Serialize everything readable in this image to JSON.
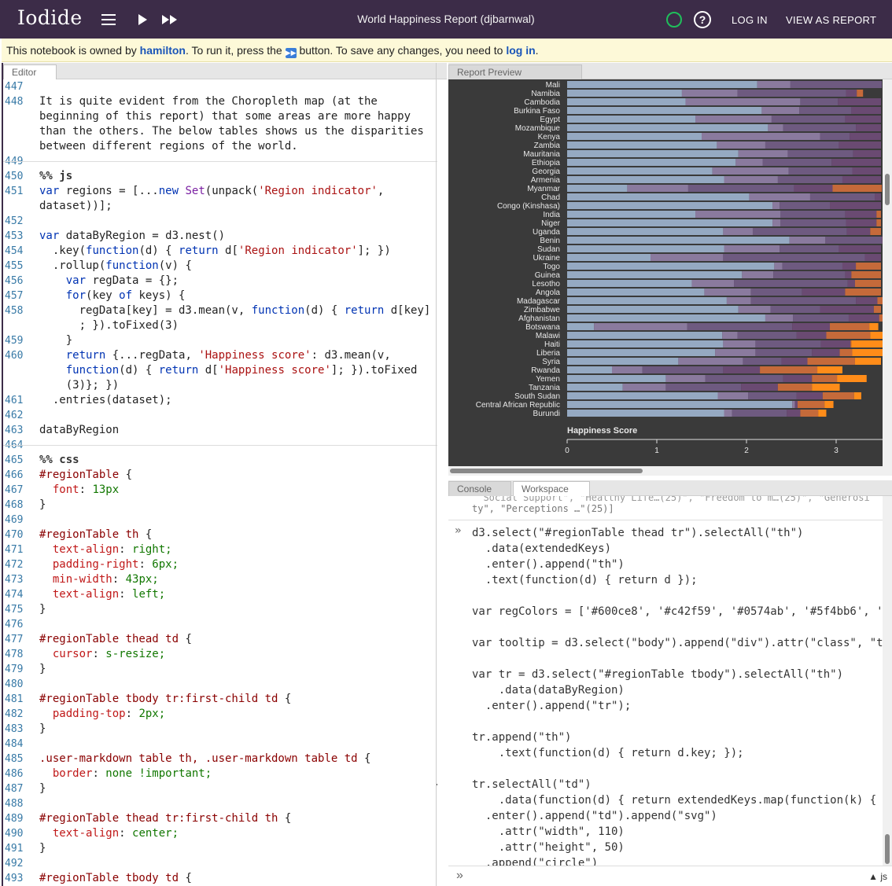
{
  "app": {
    "logo": "Iodide",
    "notebook_title": "World Happiness Report (djbarnwal)",
    "login_label": "LOG IN",
    "view_as_report_label": "VIEW AS REPORT"
  },
  "notice": {
    "prefix": "This notebook is owned by ",
    "owner": "hamilton",
    "middle": ". To run it, press the ",
    "button_glyph": "⏩",
    "after_button": " button. To save any changes, you need to ",
    "login_link": "log in",
    "suffix": "."
  },
  "editor": {
    "tab_label": "Editor",
    "lines": [
      {
        "n": "447",
        "t": ""
      },
      {
        "n": "448",
        "t": "It is quite evident from the Choropleth map (at the"
      },
      {
        "n": "",
        "t": "beginning of this report) that some areas are more happy"
      },
      {
        "n": "",
        "t": "than the others. The below tables shows us the disparities"
      },
      {
        "n": "",
        "t": "between different regions of the world."
      },
      {
        "n": "449",
        "t": ""
      },
      {
        "n": "450",
        "t": "%% js"
      },
      {
        "n": "451",
        "t": "var regions = [...new Set(unpack('Region indicator',"
      },
      {
        "n": "",
        "t": "dataset))];"
      },
      {
        "n": "452",
        "t": ""
      },
      {
        "n": "453",
        "t": "var dataByRegion = d3.nest()"
      },
      {
        "n": "454",
        "t": "  .key(function(d) { return d['Region indicator']; })"
      },
      {
        "n": "455",
        "t": "  .rollup(function(v) {"
      },
      {
        "n": "456",
        "t": "    var regData = {};"
      },
      {
        "n": "457",
        "t": "    for(key of keys) {"
      },
      {
        "n": "458",
        "t": "      regData[key] = d3.mean(v, function(d) { return d[key]"
      },
      {
        "n": "",
        "t": "      ; }).toFixed(3)"
      },
      {
        "n": "459",
        "t": "    }"
      },
      {
        "n": "460",
        "t": "    return {...regData, 'Happiness score': d3.mean(v,"
      },
      {
        "n": "",
        "t": "    function(d) { return d['Happiness score']; }).toFixed"
      },
      {
        "n": "",
        "t": "    (3)}; })"
      },
      {
        "n": "461",
        "t": "  .entries(dataset);"
      },
      {
        "n": "462",
        "t": ""
      },
      {
        "n": "463",
        "t": "dataByRegion"
      },
      {
        "n": "464",
        "t": ""
      },
      {
        "n": "465",
        "t": "%% css"
      },
      {
        "n": "466",
        "t": "#regionTable {"
      },
      {
        "n": "467",
        "t": "  font: 13px"
      },
      {
        "n": "468",
        "t": "}"
      },
      {
        "n": "469",
        "t": ""
      },
      {
        "n": "470",
        "t": "#regionTable th {"
      },
      {
        "n": "471",
        "t": "  text-align: right;"
      },
      {
        "n": "472",
        "t": "  padding-right: 6px;"
      },
      {
        "n": "473",
        "t": "  min-width: 43px;"
      },
      {
        "n": "474",
        "t": "  text-align: left;"
      },
      {
        "n": "475",
        "t": "}"
      },
      {
        "n": "476",
        "t": ""
      },
      {
        "n": "477",
        "t": "#regionTable thead td {"
      },
      {
        "n": "478",
        "t": "  cursor: s-resize;"
      },
      {
        "n": "479",
        "t": "}"
      },
      {
        "n": "480",
        "t": ""
      },
      {
        "n": "481",
        "t": "#regionTable tbody tr:first-child td {"
      },
      {
        "n": "482",
        "t": "  padding-top: 2px;"
      },
      {
        "n": "483",
        "t": "}"
      },
      {
        "n": "484",
        "t": ""
      },
      {
        "n": "485",
        "t": ".user-markdown table th, .user-markdown table td {"
      },
      {
        "n": "486",
        "t": "  border: none !important;"
      },
      {
        "n": "487",
        "t": "}"
      },
      {
        "n": "488",
        "t": ""
      },
      {
        "n": "489",
        "t": "#regionTable thead tr:first-child th {"
      },
      {
        "n": "490",
        "t": "  text-align: center;"
      },
      {
        "n": "491",
        "t": "}"
      },
      {
        "n": "492",
        "t": ""
      },
      {
        "n": "493",
        "t": "#regionTable tbody td {"
      },
      {
        "n": "494",
        "t": "  padding: 0;"
      }
    ]
  },
  "preview": {
    "tab_label": "Report Preview"
  },
  "chart_data": {
    "type": "bar",
    "stacked": true,
    "orientation": "horizontal",
    "xlabel": "Happiness Score",
    "xticks": [
      "0",
      "1",
      "2",
      "3"
    ],
    "xlim": [
      0,
      3.5
    ],
    "colors": [
      "#95a9c2",
      "#8a7a9e",
      "#6e5a80",
      "#6a4a72",
      "#c56a3a",
      "#ff8c19"
    ],
    "rows": [
      {
        "label": "Mali",
        "v": [
          2.12,
          0.37,
          1.02,
          0.0,
          0.0,
          0.0
        ]
      },
      {
        "label": "Namibia",
        "v": [
          1.28,
          0.62,
          1.21,
          0.12,
          0.07,
          0.0
        ]
      },
      {
        "label": "Cambodia",
        "v": [
          1.32,
          1.28,
          0.42,
          0.48,
          0.0,
          0.0
        ]
      },
      {
        "label": "Burkina Faso",
        "v": [
          2.17,
          0.42,
          0.58,
          0.33,
          0.0,
          0.0
        ]
      },
      {
        "label": "Egypt",
        "v": [
          1.43,
          0.85,
          0.82,
          0.4,
          0.0,
          0.0
        ]
      },
      {
        "label": "Mozambique",
        "v": [
          2.24,
          0.17,
          0.81,
          0.28,
          0.0,
          0.0
        ]
      },
      {
        "label": "Kenya",
        "v": [
          1.5,
          1.32,
          0.33,
          0.35,
          0.0,
          0.0
        ]
      },
      {
        "label": "Zambia",
        "v": [
          1.67,
          0.54,
          0.82,
          0.47,
          0.0,
          0.0
        ]
      },
      {
        "label": "Mauritania",
        "v": [
          1.91,
          0.55,
          0.73,
          0.31,
          0.0,
          0.0
        ]
      },
      {
        "label": "Ethiopia",
        "v": [
          1.88,
          0.3,
          0.77,
          0.55,
          0.0,
          0.0
        ]
      },
      {
        "label": "Georgia",
        "v": [
          1.62,
          0.85,
          0.71,
          0.32,
          0.0,
          0.0
        ]
      },
      {
        "label": "Armenia",
        "v": [
          1.75,
          0.6,
          0.72,
          0.43,
          0.0,
          0.0
        ]
      },
      {
        "label": "Myanmar",
        "v": [
          0.67,
          0.68,
          1.18,
          0.43,
          0.55,
          0.0
        ]
      },
      {
        "label": "Chad",
        "v": [
          2.03,
          0.68,
          0.72,
          0.07,
          0.0,
          0.0
        ]
      },
      {
        "label": "Congo (Kinshasa)",
        "v": [
          2.29,
          0.08,
          0.56,
          0.57,
          0.0,
          0.0
        ]
      },
      {
        "label": "India",
        "v": [
          1.43,
          0.95,
          0.72,
          0.35,
          0.05,
          0.0
        ]
      },
      {
        "label": "Niger",
        "v": [
          2.29,
          0.09,
          0.73,
          0.34,
          0.05,
          0.0
        ]
      },
      {
        "label": "Uganda",
        "v": [
          1.74,
          0.33,
          1.05,
          0.26,
          0.12,
          0.0
        ]
      },
      {
        "label": "Benin",
        "v": [
          2.48,
          0.4,
          0.63,
          0.2,
          0.19,
          0.0
        ]
      },
      {
        "label": "Sudan",
        "v": [
          1.75,
          0.62,
          0.66,
          0.47,
          0.0,
          0.0
        ]
      },
      {
        "label": "Ukraine",
        "v": [
          0.93,
          0.81,
          1.58,
          0.18,
          0.0,
          0.0
        ]
      },
      {
        "label": "Togo",
        "v": [
          2.31,
          0.09,
          0.67,
          0.15,
          0.28,
          0.0
        ]
      },
      {
        "label": "Guinea",
        "v": [
          1.95,
          0.35,
          0.8,
          0.07,
          0.33,
          0.0
        ]
      },
      {
        "label": "Lesotho",
        "v": [
          1.39,
          0.47,
          1.27,
          0.08,
          0.29,
          0.0
        ]
      },
      {
        "label": "Angola",
        "v": [
          1.53,
          0.52,
          0.57,
          0.48,
          0.4,
          0.0
        ]
      },
      {
        "label": "Madagascar",
        "v": [
          1.78,
          0.27,
          1.17,
          0.24,
          0.1,
          0.0
        ]
      },
      {
        "label": "Zimbabwe",
        "v": [
          1.91,
          0.36,
          0.55,
          0.6,
          0.08,
          0.0
        ]
      },
      {
        "label": "Afghanistan",
        "v": [
          2.21,
          0.31,
          0.62,
          0.34,
          0.18,
          0.0
        ]
      },
      {
        "label": "Botswana",
        "v": [
          0.3,
          1.04,
          1.17,
          0.42,
          0.44,
          0.1
        ]
      },
      {
        "label": "Malawi",
        "v": [
          1.73,
          0.17,
          0.66,
          0.33,
          0.49,
          0.15
        ]
      },
      {
        "label": "Haiti",
        "v": [
          1.74,
          0.36,
          0.73,
          0.33,
          0.01,
          0.41
        ]
      },
      {
        "label": "Liberia",
        "v": [
          1.65,
          0.45,
          0.63,
          0.31,
          0.14,
          0.37
        ]
      },
      {
        "label": "Syria",
        "v": [
          1.24,
          0.72,
          0.43,
          0.29,
          0.53,
          0.29
        ]
      },
      {
        "label": "Rwanda",
        "v": [
          0.5,
          0.34,
          0.9,
          0.41,
          0.64,
          0.28
        ]
      },
      {
        "label": "Yemen",
        "v": [
          1.1,
          0.44,
          0.87,
          0.32,
          0.28,
          0.33
        ]
      },
      {
        "label": "Tanzania",
        "v": [
          0.62,
          0.48,
          0.84,
          0.41,
          0.38,
          0.31
        ]
      },
      {
        "label": "South Sudan",
        "v": [
          1.68,
          0.34,
          0.54,
          0.29,
          0.35,
          0.08
        ]
      },
      {
        "label": "Central African Republic",
        "v": [
          2.51,
          0.03,
          0.0,
          0.03,
          0.3,
          0.1
        ]
      },
      {
        "label": "Burundi",
        "v": [
          1.75,
          0.09,
          0.61,
          0.15,
          0.2,
          0.09
        ]
      }
    ]
  },
  "console": {
    "tab_console": "Console",
    "tab_workspace": "Workspace",
    "partial_line_1": "  Social Support\", \"Healthy Life…(25)\", \"Freedom to m…(25)\", \"Generosi",
    "partial_line_2": "ty\", \"Perceptions …\"(25)]",
    "lines": [
      "d3.select(\"#regionTable thead tr\").selectAll(\"th\")",
      "  .data(extendedKeys)",
      "  .enter().append(\"th\")",
      "  .text(function(d) { return d });",
      "",
      "var regColors = ['#600ce8', '#c42f59', '#0574ab', '#5f4bb6', '",
      "",
      "var tooltip = d3.select(\"body\").append(\"div\").attr(\"class\", \"t",
      "",
      "var tr = d3.select(\"#regionTable tbody\").selectAll(\"th\")",
      "    .data(dataByRegion)",
      "  .enter().append(\"tr\");",
      "",
      "tr.append(\"th\")",
      "    .text(function(d) { return d.key; });",
      "",
      "tr.selectAll(\"td\")",
      "    .data(function(d) { return extendedKeys.map(function(k) {",
      "  .enter().append(\"td\").append(\"svg\")",
      "    .attr(\"width\", 110)",
      "    .attr(\"height\", 50)",
      "  .append(\"circle\")"
    ],
    "input_lang": "js"
  }
}
